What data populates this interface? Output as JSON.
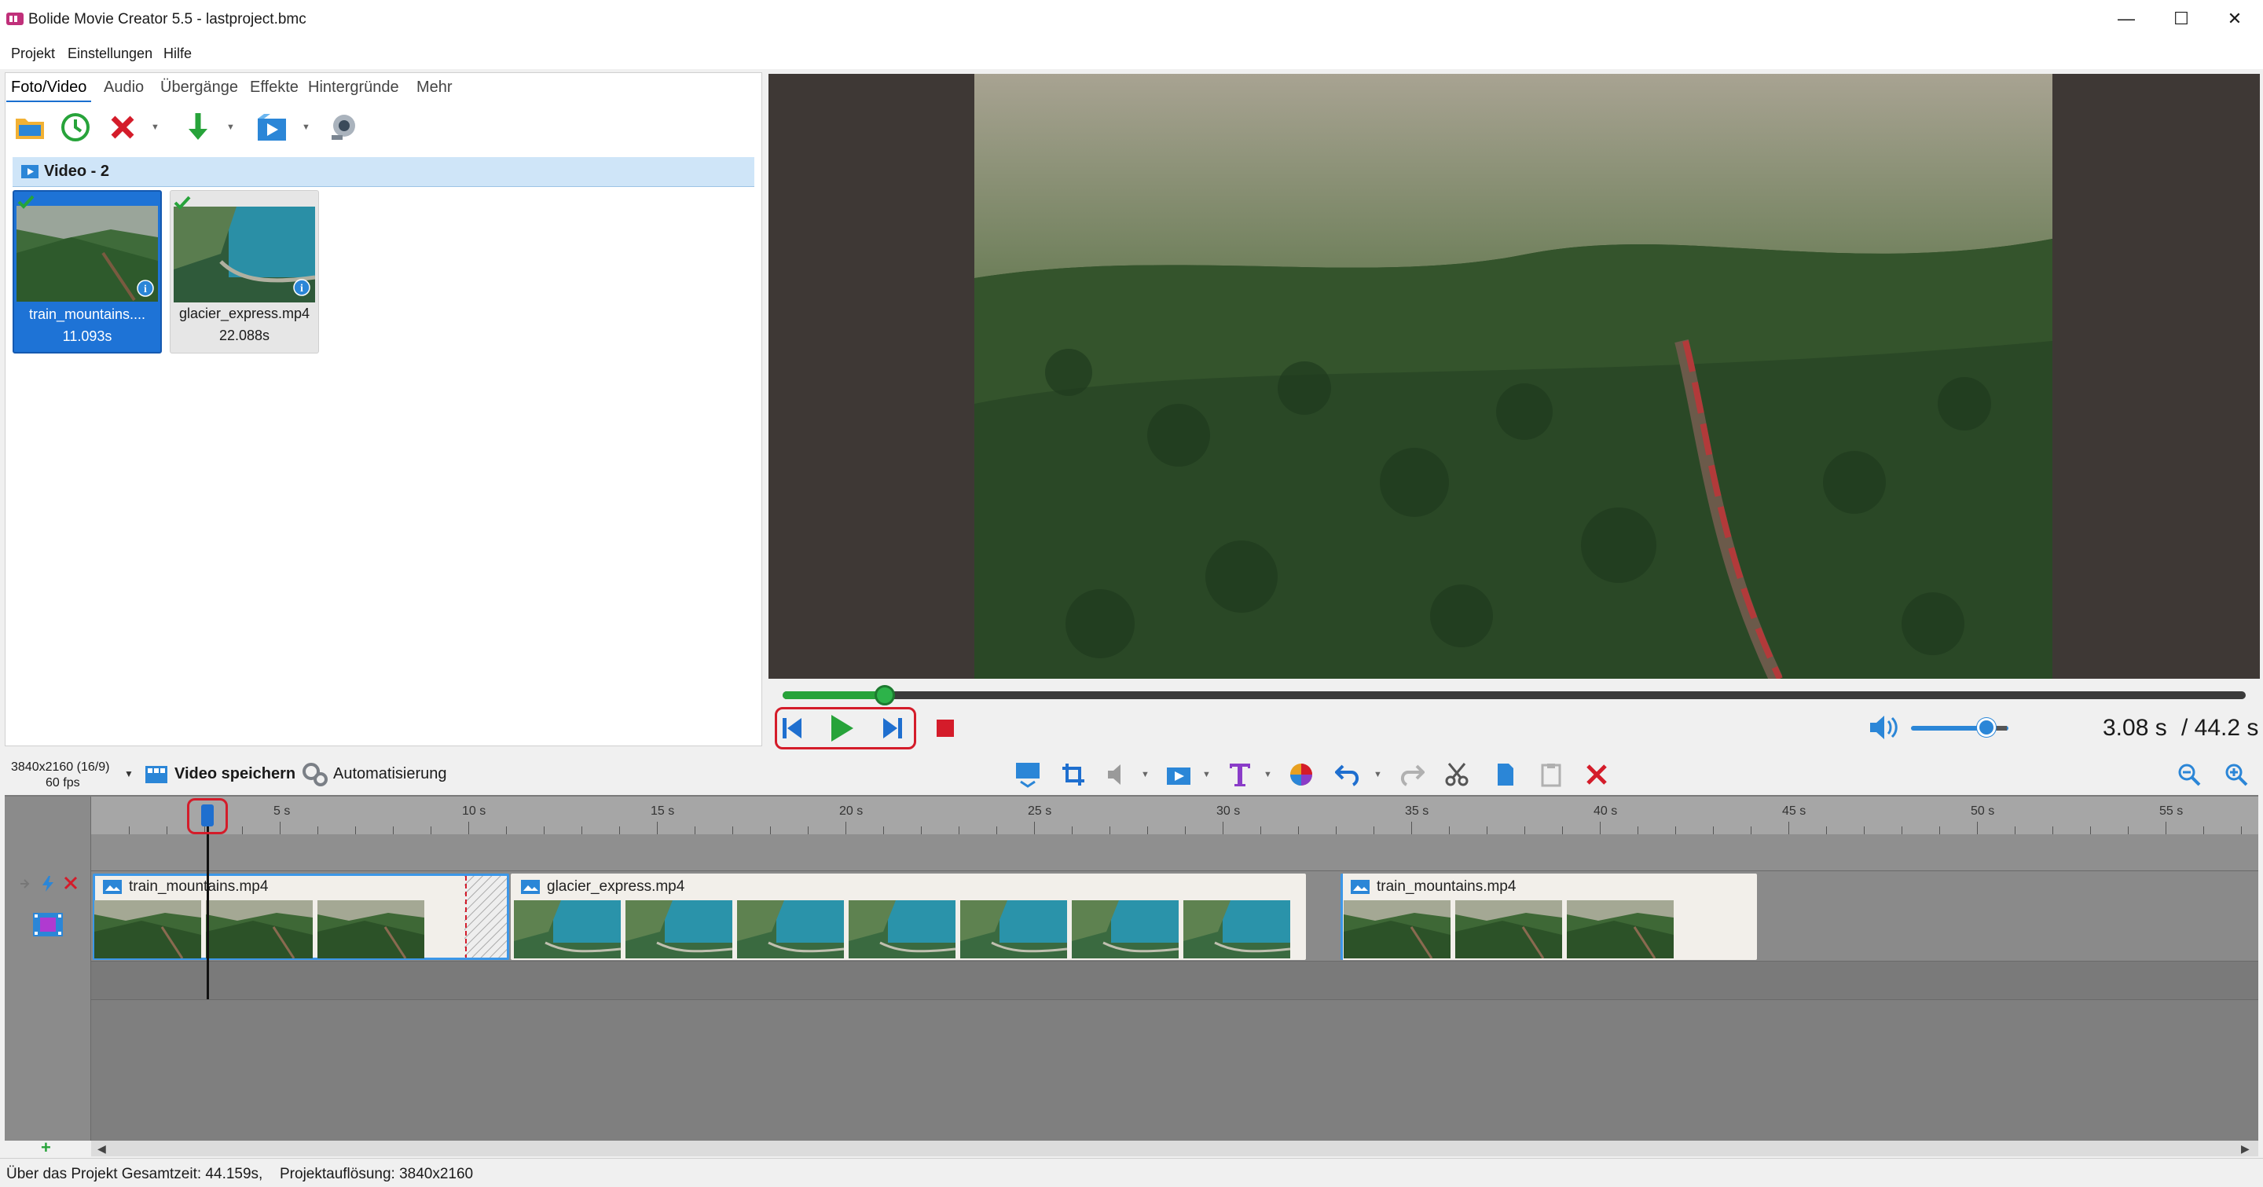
{
  "window": {
    "title": "Bolide Movie Creator 5.5 - lastproject.bmc",
    "controls": [
      "—",
      "☐",
      "✕"
    ]
  },
  "menu": [
    "Projekt",
    "Einstellungen",
    "Hilfe"
  ],
  "media_panel": {
    "tabs": [
      "Foto/Video",
      "Audio",
      "Übergänge",
      "Effekte",
      "Hintergründe",
      "Mehr"
    ],
    "active_tab": "Foto/Video",
    "group_title": "Video - 2",
    "items": [
      {
        "name": "train_mountains....",
        "duration": "11.093s",
        "selected": true
      },
      {
        "name": "glacier_express.mp4",
        "duration": "22.088s",
        "selected": false
      }
    ]
  },
  "player": {
    "current_time": "3.08 s",
    "total_time": "/ 44.2 s",
    "progress": 0.07,
    "volume": 0.8
  },
  "project_settings": {
    "resolution_label": "3840x2160 (16/9)",
    "fps_label": "60 fps",
    "save_video": "Video speichern",
    "automation": "Automatisierung"
  },
  "timeline": {
    "tick_labels": [
      "5 s",
      "10 s",
      "15 s",
      "20 s",
      "25 s",
      "30 s",
      "35 s",
      "40 s",
      "45 s",
      "50 s",
      "55 s"
    ],
    "clips": [
      {
        "name": "train_mountains.mp4",
        "start_s": 0,
        "end_s": 11.093
      },
      {
        "name": "glacier_express.mp4",
        "start_s": 11.093,
        "end_s": 33.181
      },
      {
        "name": "train_mountains.mp4",
        "start_s": 33.181,
        "end_s": 44.274
      }
    ]
  },
  "status": {
    "summary": "Über das Projekt Gesamtzeit: 44.159s,",
    "resolution": "Projektauflösung:   3840x2160"
  },
  "colors": {
    "accent": "#1f6fcf",
    "play_green": "#27a33a",
    "delete_red": "#d41c2a"
  }
}
